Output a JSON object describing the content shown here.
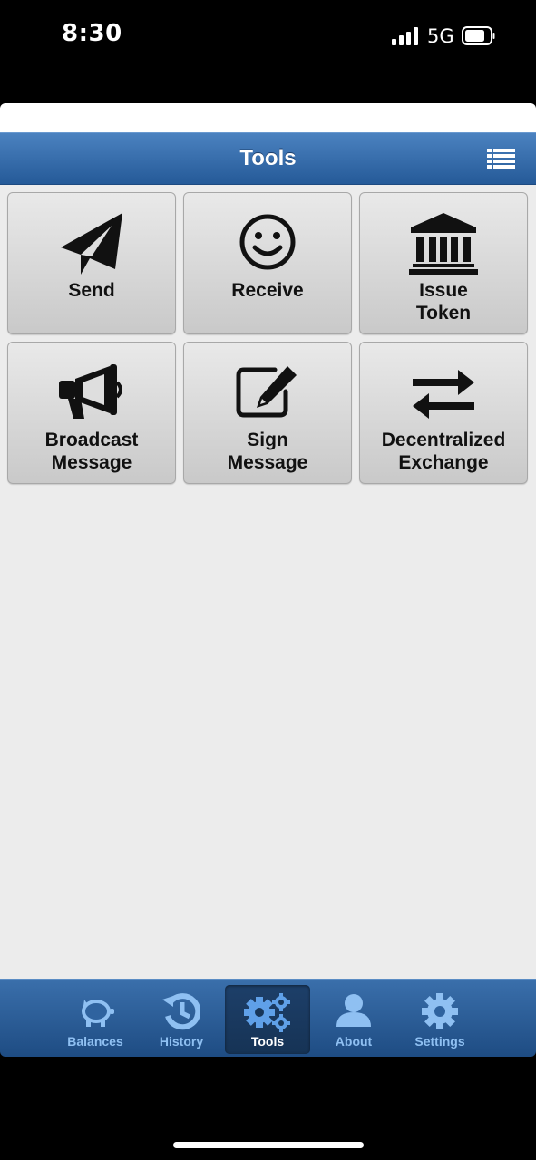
{
  "status_bar": {
    "time": "8:30",
    "network": "5G"
  },
  "header": {
    "title": "Tools"
  },
  "tools": [
    {
      "line1": "Send",
      "line2": "",
      "icon": "paper-plane-icon"
    },
    {
      "line1": "Receive",
      "line2": "",
      "icon": "smiley-icon"
    },
    {
      "line1": "Issue",
      "line2": "Token",
      "icon": "bank-icon"
    },
    {
      "line1": "Broadcast",
      "line2": "Message",
      "icon": "megaphone-icon"
    },
    {
      "line1": "Sign",
      "line2": "Message",
      "icon": "edit-icon"
    },
    {
      "line1": "Decentralized",
      "line2": "Exchange",
      "icon": "exchange-arrows-icon"
    }
  ],
  "tabbar": {
    "tabs": [
      {
        "label": "Balances",
        "icon": "piggy-bank-icon"
      },
      {
        "label": "History",
        "icon": "history-icon"
      },
      {
        "label": "Tools",
        "icon": "gears-icon",
        "active": true
      },
      {
        "label": "About",
        "icon": "user-icon"
      },
      {
        "label": "Settings",
        "icon": "gear-icon"
      }
    ]
  },
  "colors": {
    "header_top": "#4b82c0",
    "header_bottom": "#255a98",
    "tab_inactive": "#8fc0f2",
    "content_bg": "#ececec"
  }
}
